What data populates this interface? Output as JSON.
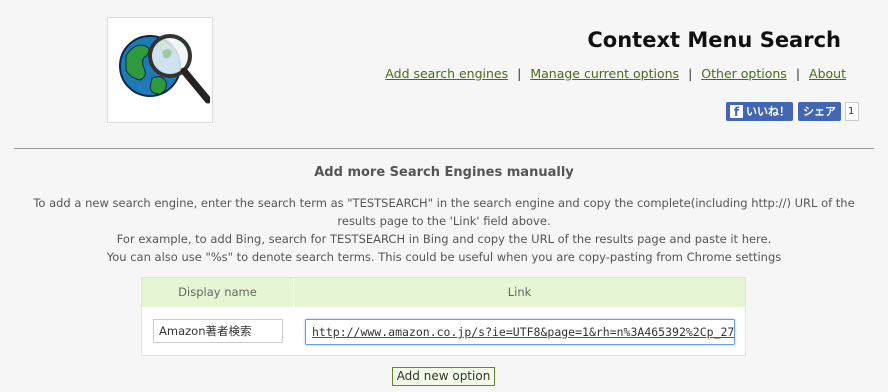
{
  "header": {
    "title": "Context Menu Search",
    "logo_icon": "globe-magnifier-icon"
  },
  "nav": {
    "items": [
      {
        "label": "Add search engines"
      },
      {
        "label": "Manage current options"
      },
      {
        "label": "Other options"
      },
      {
        "label": "About"
      }
    ],
    "separator": "|"
  },
  "social": {
    "like_label": "いいね！",
    "like_logo": "f",
    "share_label": "シェア",
    "count": "1"
  },
  "section": {
    "title": "Add more Search Engines manually",
    "desc_lines": [
      "To add a new search engine, enter the search term as \"TESTSEARCH\" in the search engine and copy the complete(including http://) URL of the results page to the 'Link' field above.",
      "For example, to add Bing, search for TESTSEARCH in Bing and copy the URL of the results page and paste it here.",
      "You can also use \"%s\" to denote search terms. This could be useful when you are copy-pasting from Chrome settings"
    ]
  },
  "table": {
    "col_name": "Display name",
    "col_link": "Link",
    "name_value": "Amazon著者検索",
    "link_value": "http://www.amazon.co.jp/s?ie=UTF8&page=1&rh=n%3A465392%2Cp_27"
  },
  "add_button": "Add new option",
  "colors": {
    "link": "#4a6a1a",
    "header_bg": "#e6f6d4",
    "facebook": "#4267b2"
  }
}
